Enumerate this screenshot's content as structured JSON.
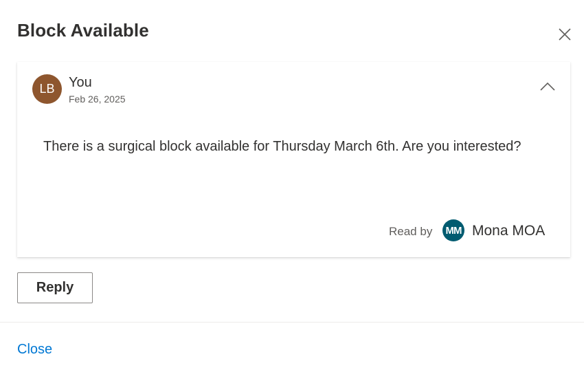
{
  "dialog": {
    "title": "Block Available",
    "close_icon": "close-icon"
  },
  "message": {
    "avatar_initials": "LB",
    "avatar_color": "#8e562e",
    "sender": "You",
    "date": "Feb 26, 2025",
    "collapse_icon": "chevron-up-icon",
    "body": "There is a surgical block available for Thursday March 6th. Are you interested?",
    "read_by_label": "Read by",
    "reader": {
      "initials": "MM",
      "avatar_color": "#005b70",
      "name": "Mona MOA"
    }
  },
  "actions": {
    "reply_label": "Reply",
    "close_label": "Close"
  },
  "colors": {
    "link": "#0078d4",
    "text": "#323130",
    "secondary_text": "#605e5c"
  }
}
